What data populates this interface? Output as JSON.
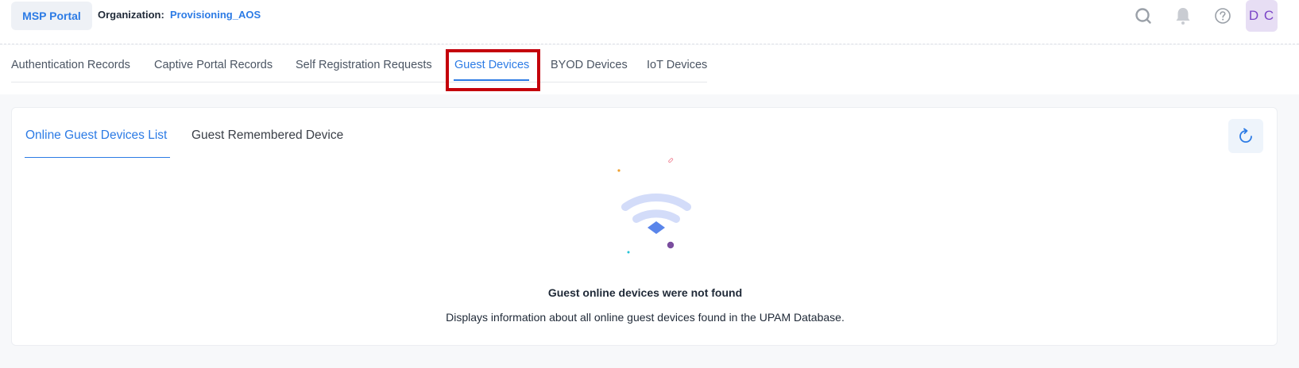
{
  "header": {
    "portal_button": "MSP Portal",
    "organization_label": "Organization:",
    "organization_value": "Provisioning_AOS",
    "avatar_initials": "D C",
    "icons": [
      "search-icon",
      "bell-icon",
      "help-icon"
    ]
  },
  "nav": {
    "tabs": [
      {
        "label": "Authentication Records"
      },
      {
        "label": "Captive Portal Records"
      },
      {
        "label": "Self Registration Requests"
      },
      {
        "label": "Guest Devices"
      },
      {
        "label": "BYOD Devices"
      },
      {
        "label": "IoT Devices"
      }
    ],
    "active": "Guest Devices"
  },
  "subtabs": {
    "items": [
      {
        "label": "Online Guest Devices List"
      },
      {
        "label": "Guest Remembered Device"
      }
    ],
    "active": "Online Guest Devices List"
  },
  "empty_state": {
    "title": "Guest online devices were not found",
    "description": "Displays information about all online guest devices found in the UPAM Database.",
    "illustration": "wifi-icon"
  },
  "colors": {
    "accent": "#2c7be5",
    "highlight": "#c4000b",
    "avatar_bg": "#e7def4",
    "avatar_text": "#7b45c7"
  }
}
